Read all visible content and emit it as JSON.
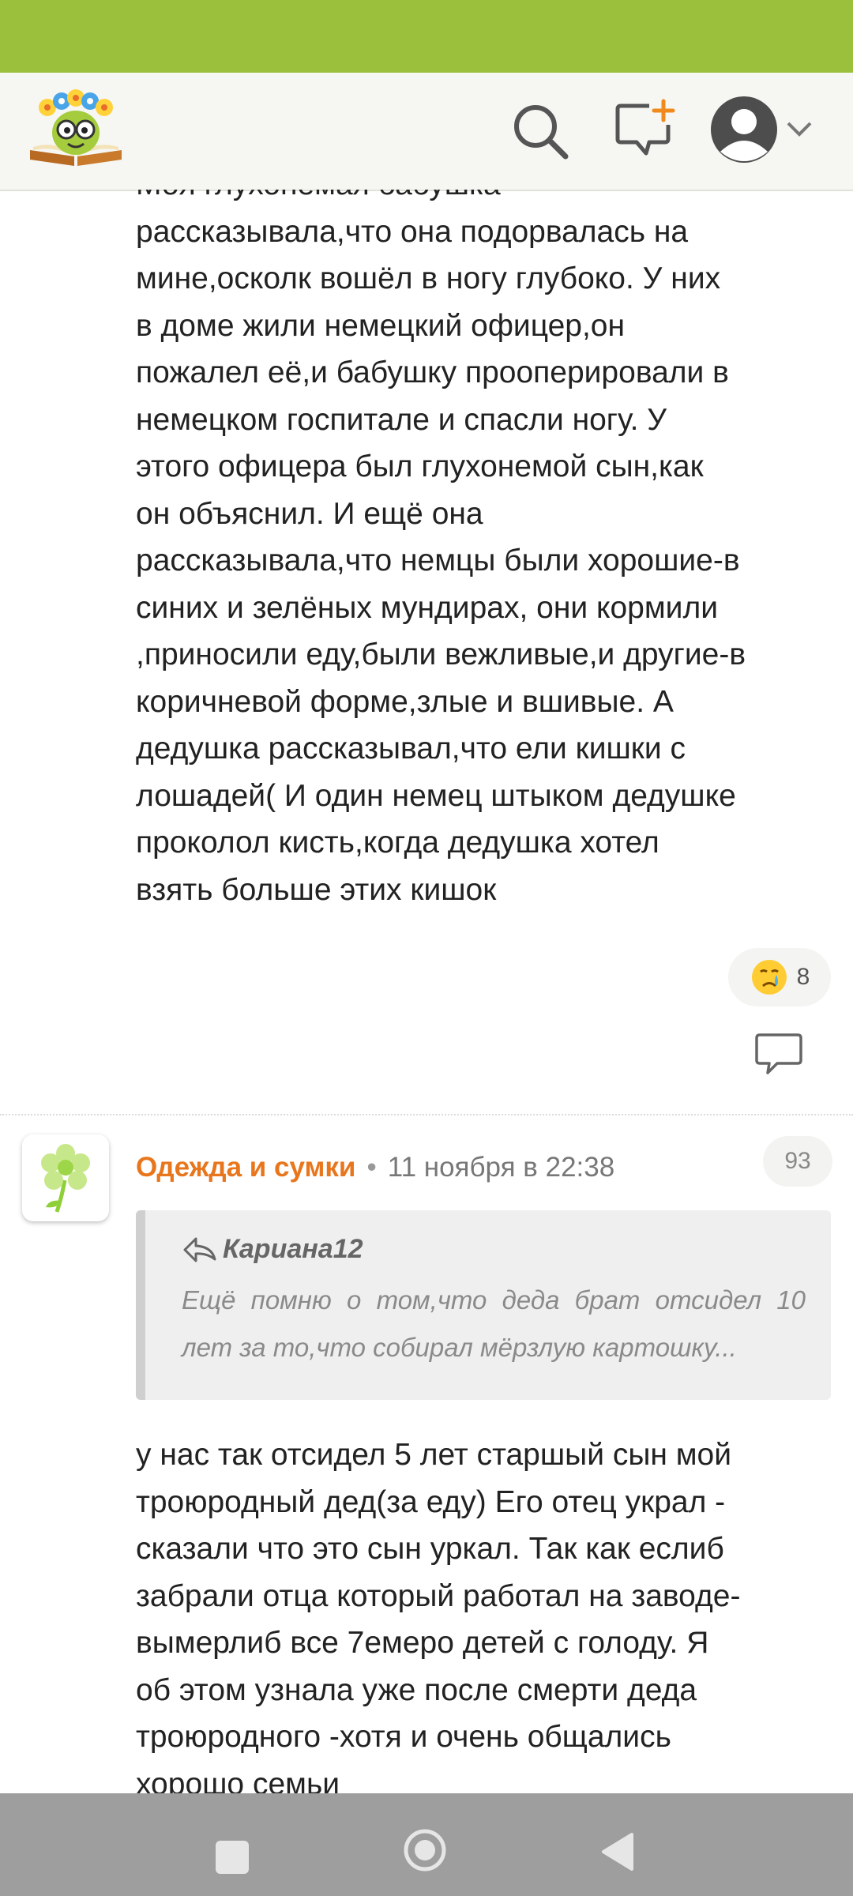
{
  "post1": {
    "lines": [
      "Моя глухонемая бабушка",
      "рассказывала,что она подорвалась на",
      "мине,осколк вошёл в ногу глубоко. У них",
      "в доме жили немецкий офицер,он",
      "пожалел её,и бабушку прооперировали в",
      "немецком госпитале и спасли ногу. У",
      "этого офицера был глухонемой сын,как",
      "он объяснил. И ещё она",
      "рассказывала,что немцы были хорошие-в",
      "синих и зелёных мундирах, они кормили",
      ",приносили еду,были вежливые,и другие-в",
      "коричневой форме,злые и вшивые. А",
      "дедушка рассказывал,что ели кишки с",
      "лошадей( И один немец штыком дедушке",
      "проколол кисть,когда дедушка хотел",
      "взять больше этих кишок"
    ],
    "reaction_emoji": "crying-face-icon",
    "reaction_count": "8"
  },
  "comment": {
    "group_name": "Одежда и сумки",
    "separator": "•",
    "time": "11 ноября в 22:38",
    "count": "93",
    "quote_author": "Кариана12",
    "quote_text": "Ещё помню о том,что деда брат отсидел 10 лет за то,что собирал мёрзлую картошку...",
    "lines": [
      "у нас так отсидел 5 лет старшый сын мой",
      "троюродный дед(за еду) Его отец украл -",
      "сказали что это сын уркал. Так как еслиб",
      "забрали отца который работал на заводе-",
      "вымерлиб все 7емеро детей с голоду. Я",
      "об этом узнала уже после смерти деда",
      "троюродного -хотя и очень общались",
      "хорошо семьи"
    ]
  },
  "colors": {
    "status_bar": "#9bc13c",
    "accent": "#e8761c",
    "nav_bar": "#9e9e9e"
  }
}
